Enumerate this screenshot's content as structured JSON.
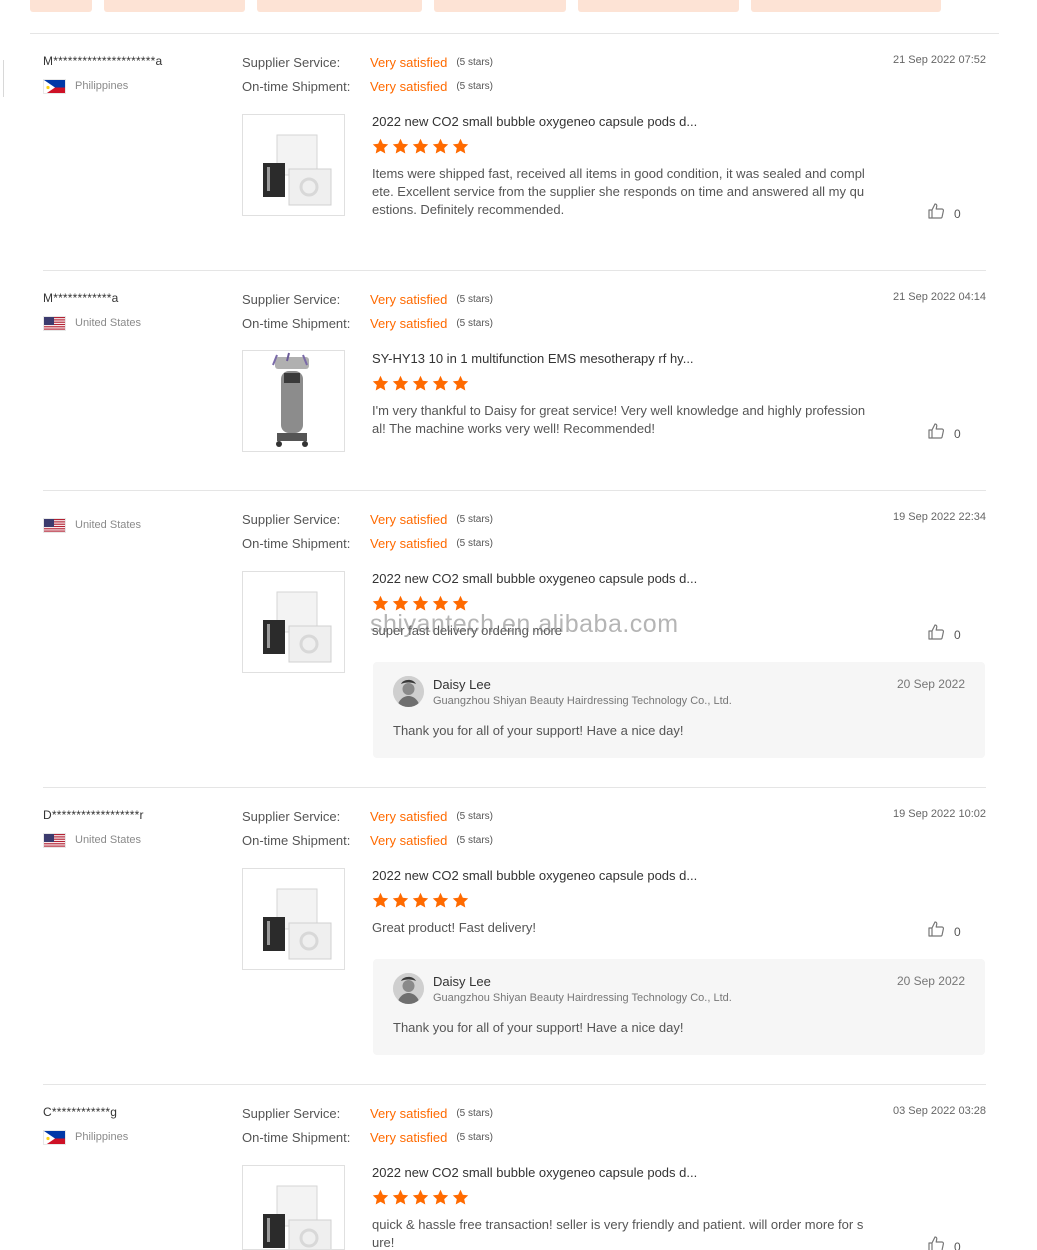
{
  "colors": {
    "accent": "#ff6a00",
    "chip": "#fde3d5",
    "reply_bg": "#f6f6f6"
  },
  "labels": {
    "supplier_service": "Supplier Service:",
    "on_time_shipment": "On-time Shipment:",
    "very_satisfied": "Very satisfied",
    "five_stars": "(5 stars)"
  },
  "watermark": "shiyantech.en.alibaba.com",
  "reviews": [
    {
      "buyer": "M*********************a",
      "country": "Philippines",
      "flag": "ph-flag-icon",
      "date": "21 Sep 2022 07:52",
      "product_title": "2022 new CO2 small bubble oxygeneo capsule pods d...",
      "product_image": "capsule-box-image",
      "text": "Items were shipped fast, received all items  in good condition, it was sealed and complete. Excellent service from the supplier she responds on time and answered all my questions. Definitely recommended.",
      "likes": "0"
    },
    {
      "buyer": "M************a",
      "country": "United States",
      "flag": "us-flag-icon",
      "date": "21 Sep 2022 04:14",
      "product_title": "SY-HY13 10 in 1 multifunction EMS mesotherapy rf hy...",
      "product_image": "machine-image",
      "text": "I'm very thankful to Daisy for great service! Very well knowledge and highly professional! The machine works very well! Recommended!",
      "likes": "0"
    },
    {
      "buyer": "",
      "country": "United States",
      "flag": "us-flag-icon",
      "date": "19 Sep 2022 22:34",
      "product_title": "2022 new CO2 small bubble oxygeneo capsule pods d...",
      "product_image": "capsule-box-image",
      "text": "super fast delivery ordering more",
      "likes": "0",
      "reply": {
        "name": "Daisy Lee",
        "company": "Guangzhou Shiyan Beauty Hairdressing Technology Co., Ltd.",
        "date": "20 Sep 2022",
        "text": "Thank you for all of your support!  Have a nice day!"
      }
    },
    {
      "buyer": "D******************r",
      "country": "United States",
      "flag": "us-flag-icon",
      "date": "19 Sep 2022 10:02",
      "product_title": "2022 new CO2 small bubble oxygeneo capsule pods d...",
      "product_image": "capsule-box-image",
      "text": "Great product! Fast delivery!",
      "likes": "0",
      "reply": {
        "name": "Daisy Lee",
        "company": "Guangzhou Shiyan Beauty Hairdressing Technology Co., Ltd.",
        "date": "20 Sep 2022",
        "text": "Thank you for all of your support!  Have a nice day!"
      }
    },
    {
      "buyer": "C************g",
      "country": "Philippines",
      "flag": "ph-flag-icon",
      "date": "03 Sep 2022 03:28",
      "product_title": "2022 new CO2 small bubble oxygeneo capsule pods d...",
      "product_image": "capsule-box-image",
      "text": "quick & hassle free transaction! seller is very friendly and patient. will order more for sure!",
      "likes": "0"
    }
  ]
}
